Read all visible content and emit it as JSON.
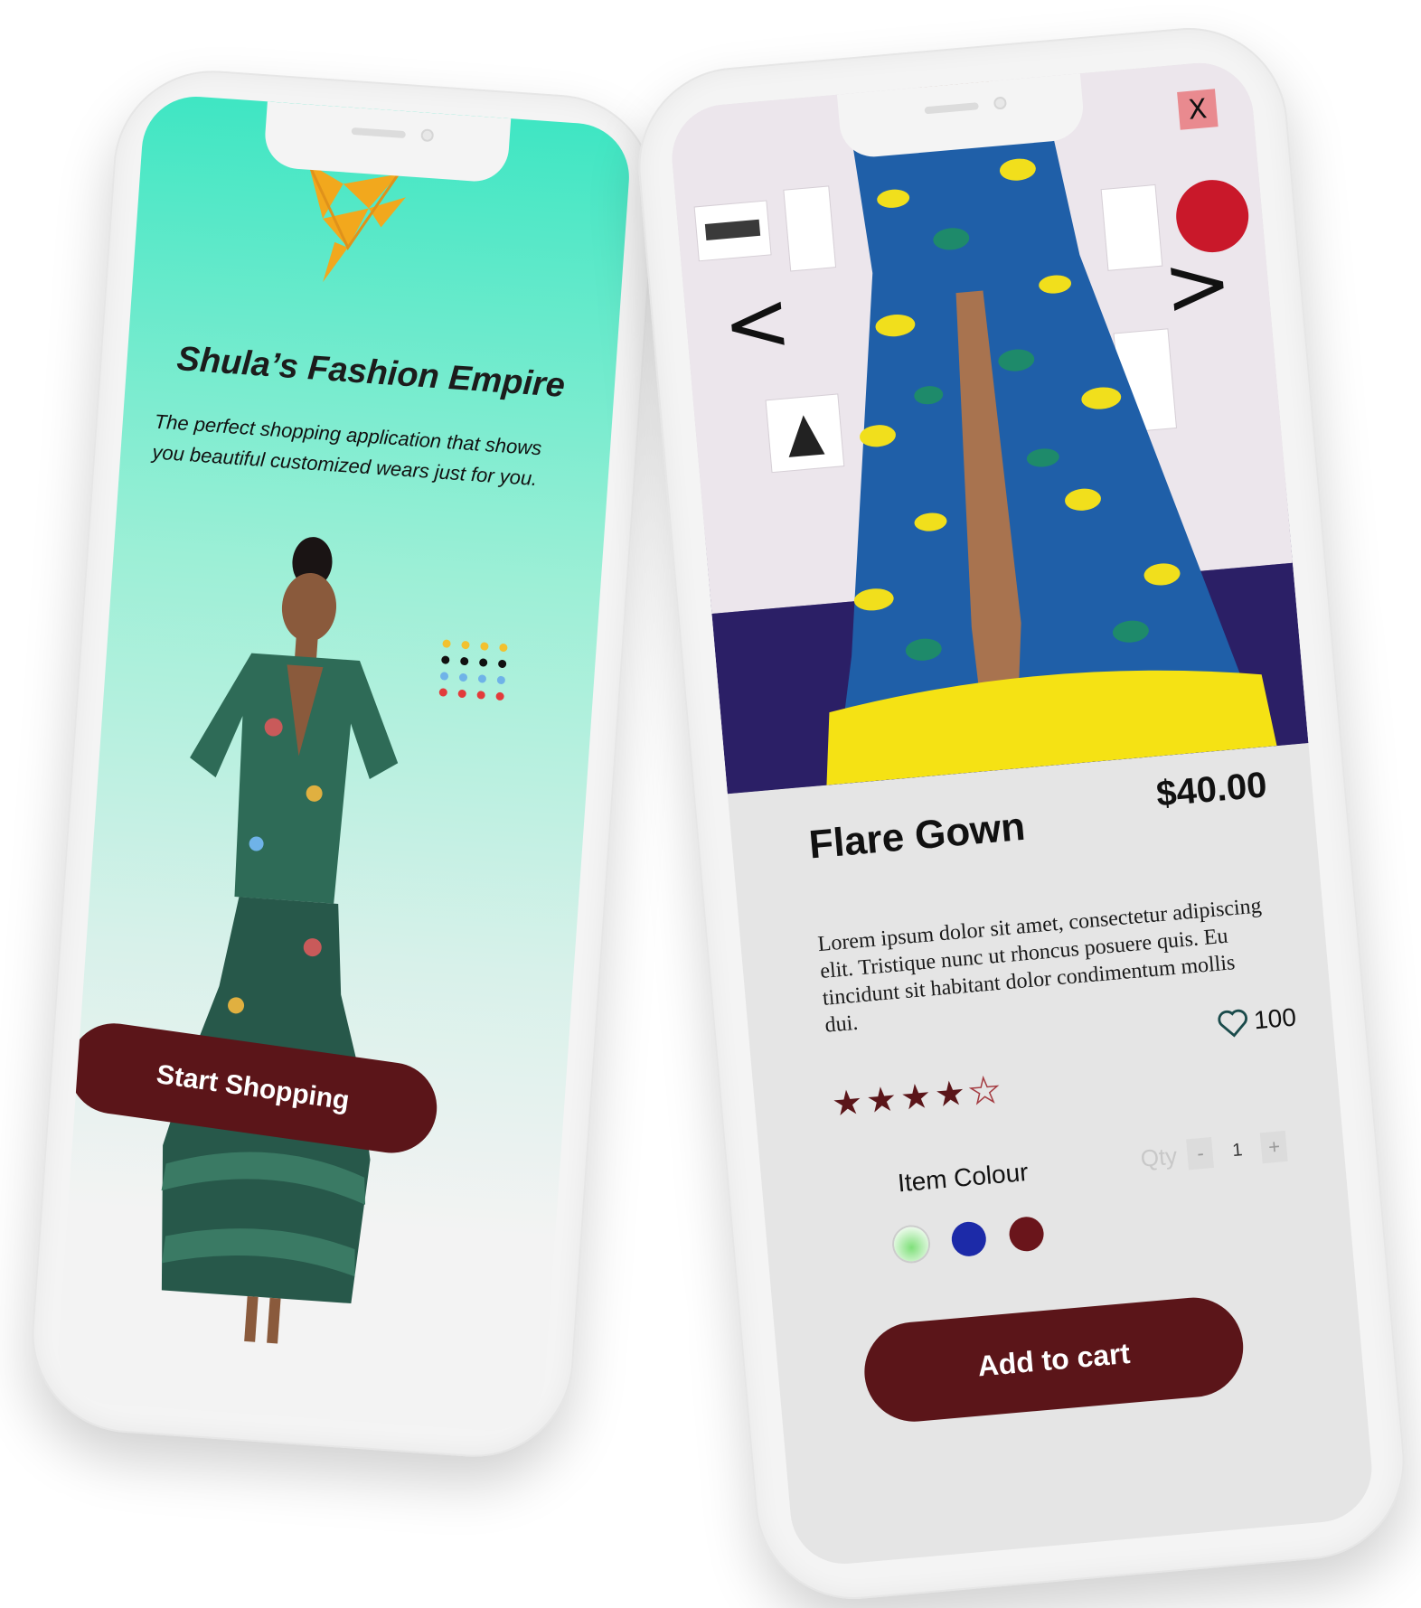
{
  "onboarding": {
    "title": "Shula’s Fashion Empire",
    "subtitle": "The perfect shopping application that shows you beautiful customized wears just for you.",
    "cta_label": "Start Shopping",
    "dot_colors": [
      "#f2c12e",
      "#f2c12e",
      "#f2c12e",
      "#f2c12e",
      "#111111",
      "#111111",
      "#111111",
      "#111111",
      "#6fb3e8",
      "#6fb3e8",
      "#6fb3e8",
      "#6fb3e8",
      "#e23b3b",
      "#e23b3b",
      "#e23b3b",
      "#e23b3b"
    ],
    "logo_color": "#f2a81d"
  },
  "product": {
    "prev_arrow": "<",
    "next_arrow": ">",
    "close_label": "X",
    "name": "Flare Gown",
    "price": "$40.00",
    "description": "Lorem ipsum dolor sit amet, consectetur adipiscing elit. Tristique nunc ut rhoncus posuere quis. Eu tincidunt sit habitant dolor condimentum mollis dui.",
    "likes": "100",
    "rating": 4,
    "rating_max": 5,
    "colour_label": "Item Colour",
    "colours": [
      "#7fe07a",
      "#1c2aa8",
      "#6a151b"
    ],
    "qty_label": "Qty",
    "qty_minus": "-",
    "qty_value": "1",
    "qty_plus": "+",
    "cta_label": "Add to cart"
  },
  "colors": {
    "brand": "#5b1519",
    "accent": "#3fe6c3"
  }
}
